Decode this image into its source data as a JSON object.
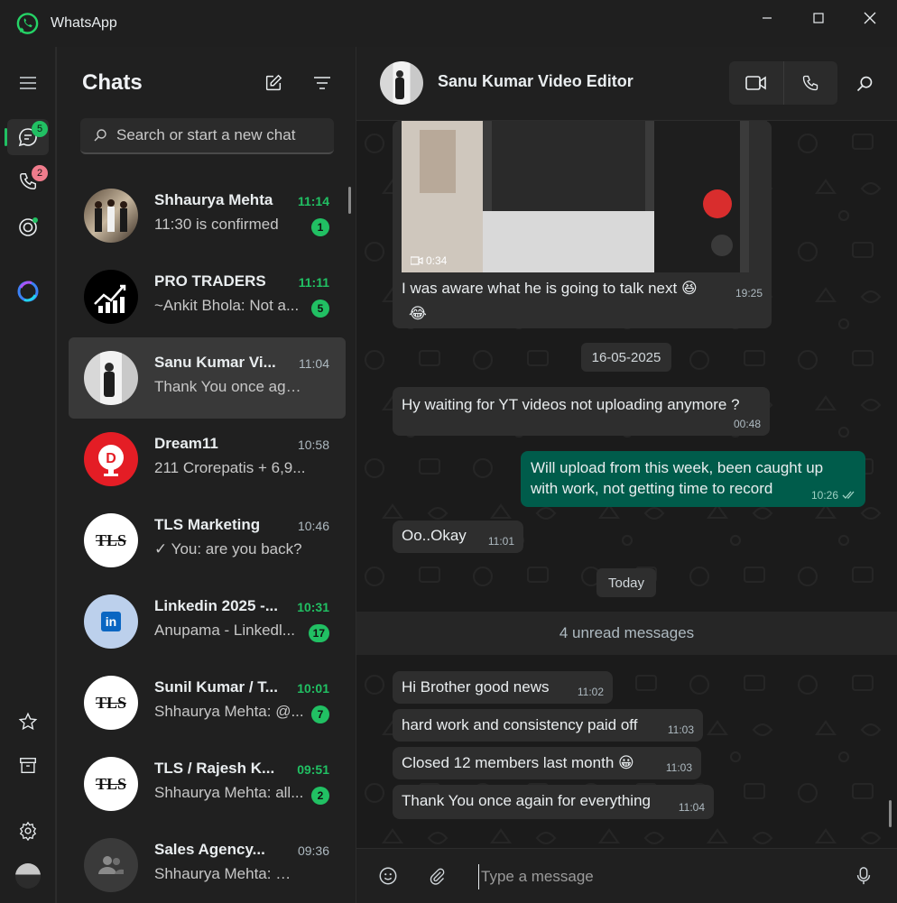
{
  "app": {
    "title": "WhatsApp"
  },
  "rail": {
    "chats_badge": "5",
    "calls_badge": "2",
    "colors": {
      "accent": "#21c063",
      "calls_badge": "#f07c8c"
    }
  },
  "chats": {
    "title": "Chats",
    "search_placeholder": "Search or start a new chat",
    "items": [
      {
        "name": "Shhaurya Mehta",
        "time": "11:14",
        "preview": "11:30 is confirmed",
        "badge": "1"
      },
      {
        "name": "PRO TRADERS",
        "time": "11:11",
        "preview": "~Ankit Bhola: Not a...",
        "badge": "5"
      },
      {
        "name": "Sanu Kumar Vi...",
        "time": "11:04",
        "preview": "Thank You once agai..."
      },
      {
        "name": "Dream11",
        "time": "10:58",
        "preview": "211 Crorepatis + 6,9..."
      },
      {
        "name": "TLS Marketing",
        "time": "10:46",
        "preview": "✓ You: are you back?"
      },
      {
        "name": "Linkedin 2025 -...",
        "time": "10:31",
        "preview": "Anupama - Linkedl...",
        "badge": "17"
      },
      {
        "name": "Sunil Kumar / T...",
        "time": "10:01",
        "preview": "Shhaurya Mehta: @...",
        "badge": "7"
      },
      {
        "name": "TLS / Rajesh K...",
        "time": "09:51",
        "preview": "Shhaurya Mehta: all...",
        "badge": "2"
      },
      {
        "name": "Sales Agency...",
        "time": "09:36",
        "preview": "Shhaurya Mehta: 🖼 ..."
      }
    ],
    "avatar_labels": {
      "tls": "TLS",
      "dream11": "D",
      "linkedin": "in"
    }
  },
  "conversation": {
    "contact_name": "Sanu Kumar Video Editor",
    "video_duration": "0:34",
    "messages": [
      {
        "text": "I was aware what he is going to talk next 😆",
        "extra": "😂",
        "time": "19:25",
        "dir": "in"
      },
      {
        "text": "Hy waiting for YT videos not uploading anymore ?",
        "time": "00:48",
        "dir": "in"
      },
      {
        "text": "Will upload from this week, been caught up",
        "text2": "with work, not getting time to record",
        "time": "10:26",
        "dir": "out"
      },
      {
        "text": "Oo..Okay",
        "time": "11:01",
        "dir": "in"
      },
      {
        "text": "Hi Brother good news",
        "time": "11:02",
        "dir": "in"
      },
      {
        "text": "hard work and consistency paid off",
        "time": "11:03",
        "dir": "in"
      },
      {
        "text": "Closed 12 members last month 😀",
        "time": "11:03",
        "dir": "in"
      },
      {
        "text": "Thank You once again for everything",
        "time": "11:04",
        "dir": "in"
      }
    ],
    "date_pills": {
      "first": "16-05-2025",
      "second": "Today"
    },
    "unread_divider": "4 unread messages",
    "composer_placeholder": "Type a message"
  }
}
